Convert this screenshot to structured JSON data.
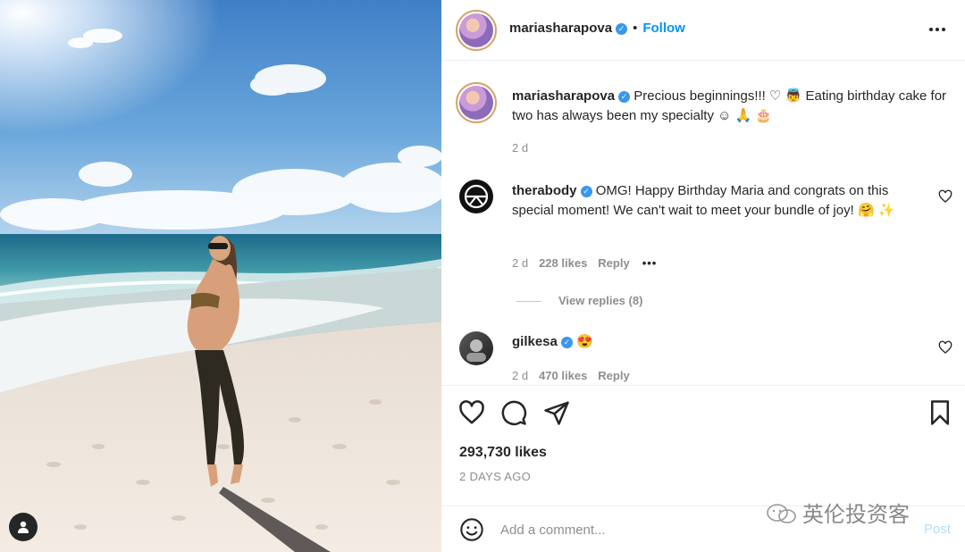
{
  "header": {
    "username": "mariasharapova",
    "separator": "•",
    "follow_label": "Follow"
  },
  "caption": {
    "username": "mariasharapova",
    "text": "Precious beginnings!!! ♡ 👼 Eating birthday cake for two has always been my specialty ☺ 🙏 🎂",
    "time": "2 d"
  },
  "comments": [
    {
      "username": "therabody",
      "text": "OMG! Happy Birthday Maria and congrats on this special moment! We can't wait to meet your bundle of joy! 🤗 ✨",
      "time": "2 d",
      "likes": "228 likes",
      "reply_label": "Reply",
      "view_replies": "View replies (8)"
    },
    {
      "username": "gilkesa",
      "text": "😍",
      "time": "2 d",
      "likes": "470 likes",
      "reply_label": "Reply"
    }
  ],
  "likes_count": "293,730 likes",
  "posted_ago": "2 DAYS AGO",
  "comment_box": {
    "placeholder": "Add a comment...",
    "post_label": "Post"
  },
  "watermark": "英伦投资客",
  "icons": {
    "like": "heart-icon",
    "comment": "comment-icon",
    "share": "paper-plane-icon",
    "save": "bookmark-icon",
    "emoji": "smiley-icon",
    "more": "more-options-icon",
    "photo_tag": "user-tag-icon"
  },
  "colors": {
    "follow": "#0095f6",
    "verified": "#3897f0",
    "post_disabled": "#b2dffc",
    "secondary_text": "#8e8e8e"
  }
}
